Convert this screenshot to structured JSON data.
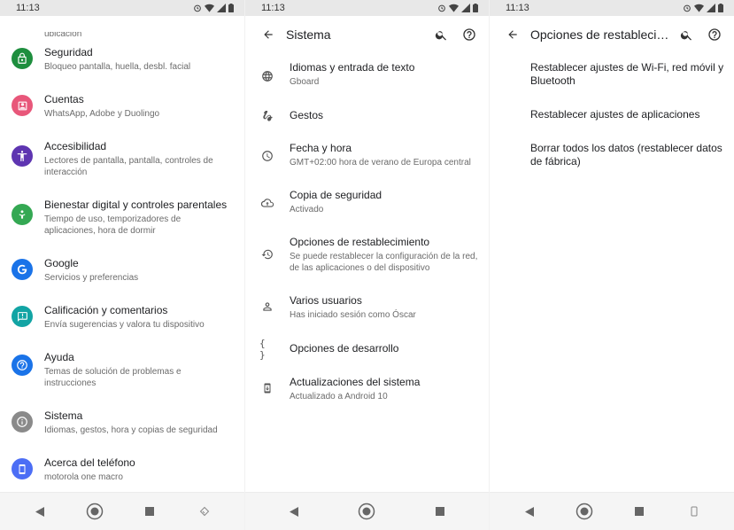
{
  "status": {
    "time": "11:13"
  },
  "screen1": {
    "cut_subtitle": "ubicación",
    "items": [
      {
        "title": "Seguridad",
        "subtitle": "Bloqueo pantalla, huella, desbl. facial",
        "icon": "lock-icon",
        "color": "#1e8e3e"
      },
      {
        "title": "Cuentas",
        "subtitle": "WhatsApp, Adobe y Duolingo",
        "icon": "account-box-icon",
        "color": "#e8577a"
      },
      {
        "title": "Accesibilidad",
        "subtitle": "Lectores de pantalla, pantalla, controles de interacción",
        "icon": "accessibility-icon",
        "color": "#5e35b1"
      },
      {
        "title": "Bienestar digital y controles parentales",
        "subtitle": "Tiempo de uso, temporizadores de aplicaciones, hora de dormir",
        "icon": "wellbeing-icon",
        "color": "#34a853"
      },
      {
        "title": "Google",
        "subtitle": "Servicios y preferencias",
        "icon": "google-icon",
        "color": "#1a73e8"
      },
      {
        "title": "Calificación y comentarios",
        "subtitle": "Envía sugerencias y valora tu dispositivo",
        "icon": "feedback-icon",
        "color": "#12a4a4"
      },
      {
        "title": "Ayuda",
        "subtitle": "Temas de solución de problemas e instrucciones",
        "icon": "help-icon",
        "color": "#1a73e8"
      },
      {
        "title": "Sistema",
        "subtitle": "Idiomas, gestos, hora y copias de seguridad",
        "icon": "info-icon",
        "color": "#8a8a8a"
      },
      {
        "title": "Acerca del teléfono",
        "subtitle": "motorola one macro",
        "icon": "phone-icon",
        "color": "#4c6ef5"
      }
    ]
  },
  "screen2": {
    "title": "Sistema",
    "items": [
      {
        "title": "Idiomas y entrada de texto",
        "subtitle": "Gboard",
        "icon": "globe-icon"
      },
      {
        "title": "Gestos",
        "subtitle": "",
        "icon": "gesture-icon"
      },
      {
        "title": "Fecha y hora",
        "subtitle": "GMT+02:00 hora de verano de Europa central",
        "icon": "clock-icon"
      },
      {
        "title": "Copia de seguridad",
        "subtitle": "Activado",
        "icon": "cloud-upload-icon"
      },
      {
        "title": "Opciones de restablecimiento",
        "subtitle": "Se puede restablecer la configuración de la red, de las aplicaciones o del dispositivo",
        "icon": "restore-icon"
      },
      {
        "title": "Varios usuarios",
        "subtitle": "Has iniciado sesión como Óscar",
        "icon": "person-icon"
      },
      {
        "title": "Opciones de desarrollo",
        "subtitle": "",
        "icon": "code-braces-icon"
      },
      {
        "title": "Actualizaciones del sistema",
        "subtitle": "Actualizado a Android 10",
        "icon": "system-update-icon"
      }
    ]
  },
  "screen3": {
    "title": "Opciones de restablecimiento",
    "items": [
      {
        "title": "Restablecer ajustes de Wi-Fi, red móvil y Bluetooth"
      },
      {
        "title": "Restablecer ajustes de aplicaciones"
      },
      {
        "title": "Borrar todos los datos (restablecer datos de fábrica)"
      }
    ]
  }
}
